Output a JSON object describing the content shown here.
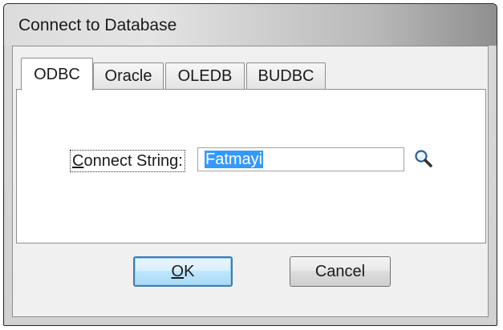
{
  "window": {
    "title": "Connect to Database"
  },
  "tabs": [
    {
      "label": "ODBC",
      "active": true
    },
    {
      "label": "Oracle",
      "active": false
    },
    {
      "label": "OLEDB",
      "active": false
    },
    {
      "label": "BUDBC",
      "active": false
    }
  ],
  "form": {
    "connect_string_mnemonic": "C",
    "connect_string_label_rest": "onnect String:",
    "connect_string_value": "Fatmayi",
    "browse_icon": "magnifier-icon"
  },
  "buttons": {
    "ok_mnemonic": "O",
    "ok_rest": "K",
    "cancel": "Cancel"
  },
  "colors": {
    "selection": "#3399ff",
    "default_button_border": "#3c7fb1"
  }
}
